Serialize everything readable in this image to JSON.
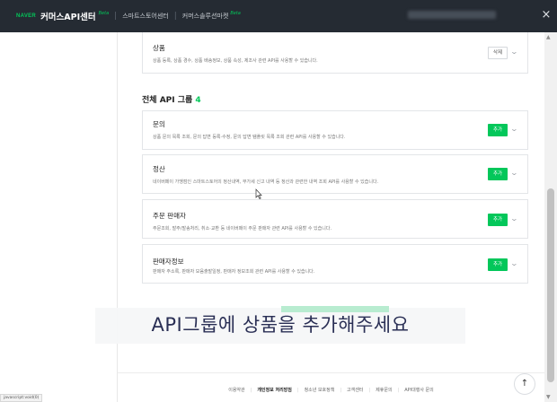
{
  "header": {
    "naver": "NAVER",
    "brand": "커머스API센터",
    "brand_badge": "Beta",
    "link_store": "스마트스토어센터",
    "link_market": "커머스솔루션마켓",
    "market_badge": "Beta",
    "close": "×"
  },
  "colors": {
    "accent": "#03c75a",
    "topbar": "#252b33"
  },
  "groups": {
    "added": [
      {
        "title": "상품",
        "desc": "상품 등록, 상품 경수, 상품 배송정보, 상품 속성, 제조사 관련 API를 사용할 수 있습니다.",
        "button": "삭제"
      }
    ],
    "section_title": "전체 API 그룹",
    "section_count": "4",
    "all": [
      {
        "title": "문의",
        "desc": "상품 문의 목록 조회, 문의 답변 등록·수정, 문의 답변 템플릿 목록 조회 관련 API를 사용할 수 있습니다.",
        "button": "추가"
      },
      {
        "title": "정산",
        "desc": "네이버페이 가맹점인 스마트스토어의 정산내역, 부가세 신고 내역 등 정산과 관련한 내역 조회 API를 사용할 수 있습니다.",
        "button": "추가"
      },
      {
        "title": "주문 판매자",
        "desc": "주문조회, 발주/발송처리, 취소·교환 등 네이버페이 주문 판매자 관련 API를 사용할 수 있습니다.",
        "button": "추가"
      },
      {
        "title": "판매자정보",
        "desc": "판매자 주소록, 판매자 모음출발일정, 판매자 정보조회 관련 API를 사용할 수 있습니다.",
        "button": "추가"
      }
    ]
  },
  "subtitle": "API그룹에 상품을 추가해주세요",
  "footer": {
    "links": [
      "이용약관",
      "개인정보 처리방침",
      "청소년 보호정책",
      "고객센터",
      "제휴문의",
      "API대행사 문의"
    ]
  },
  "top_button": "↑",
  "status_tip": "javascript:void(0)",
  "icons": {
    "chevron": "chevron-down-icon",
    "scroll_top": "arrow-up-icon"
  }
}
